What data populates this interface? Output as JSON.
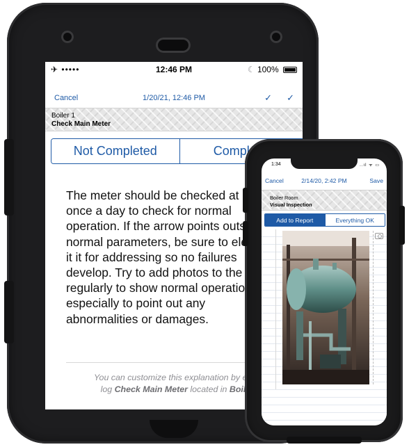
{
  "tablet": {
    "status": {
      "signal": "✈ ••••• ",
      "time": "12:46 PM",
      "battery": "100%"
    },
    "nav": {
      "cancel": "Cancel",
      "title": "1/20/21, 12:46 PM"
    },
    "header": {
      "location": "Boiler 1",
      "log_name": "Check Main Meter"
    },
    "segment": {
      "options": [
        "Not Completed",
        "Completed"
      ]
    },
    "description": "The meter should be checked at least\nonce a day to check for normal\noperation. If the arrow points outside\nnormal parameters, be sure to elevate\nit it for addressing so no failures\ndevelop. Try to add photos to the log\nregularly to show normal operation,\nespecially to point out any\nabnormalities or damages.",
    "footnote": {
      "line1": "You can customize this explanation by editing",
      "line2_prefix": "log ",
      "log_name": "Check Main Meter",
      "line2_middle": " located in ",
      "location": "Boiler 1"
    }
  },
  "phone": {
    "status": {
      "time": "1:34",
      "icons": "..ıl ᯤ ▭"
    },
    "nav": {
      "cancel": "Cancel",
      "title": "2/14/20, 2:42 PM",
      "save": "Save"
    },
    "header": {
      "location": "Boiler Room",
      "log_name": "Visual Inspection"
    },
    "segment": {
      "options": [
        "Add to Report",
        "Everything OK"
      ],
      "selected": "Add to Report"
    }
  },
  "icons": [
    "airplane-icon",
    "wifi-icon",
    "moon-icon",
    "battery-icon",
    "checkmark-icon",
    "check-all-icon",
    "camera-icon"
  ],
  "colors": {
    "accent": "#1e5aa6",
    "case": "#1d1d1f"
  }
}
